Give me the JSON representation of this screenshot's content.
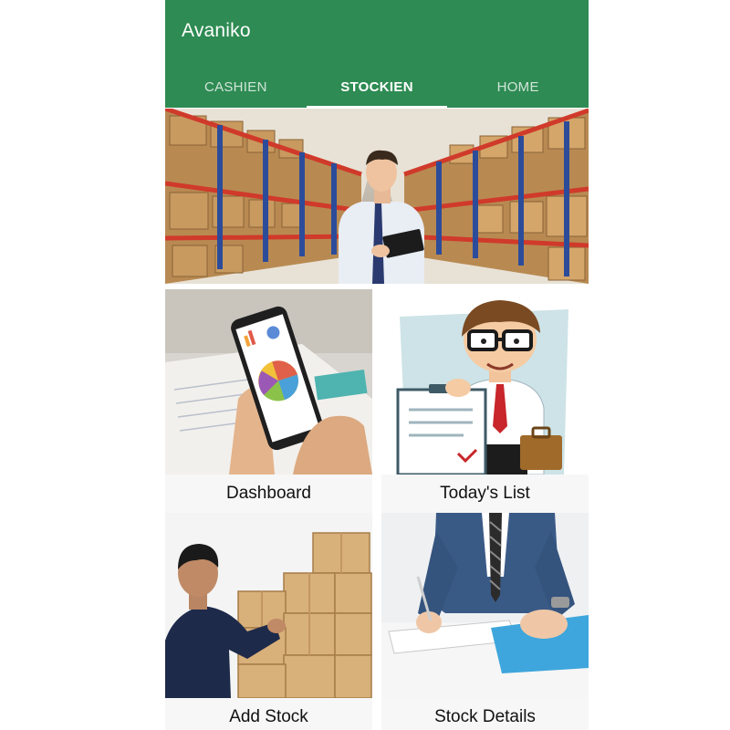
{
  "app": {
    "title": "Avaniko"
  },
  "tabs": [
    {
      "label": "CASHIEN",
      "active": false
    },
    {
      "label": "STOCKIEN",
      "active": true
    },
    {
      "label": "HOME",
      "active": false
    }
  ],
  "colors": {
    "appbar": "#2e8b53",
    "tab_indicator": "#ffffff",
    "card_bg": "#f7f7f7"
  },
  "hero": {
    "image": "warehouse-manager-photo"
  },
  "menu": [
    {
      "label": "Dashboard",
      "image": "phone-pie-chart-photo"
    },
    {
      "label": "Today's List",
      "image": "clerk-with-clipboard-illustration"
    },
    {
      "label": "Add Stock",
      "image": "worker-stacking-boxes-photo"
    },
    {
      "label": "Stock Details",
      "image": "signing-documents-photo"
    }
  ]
}
